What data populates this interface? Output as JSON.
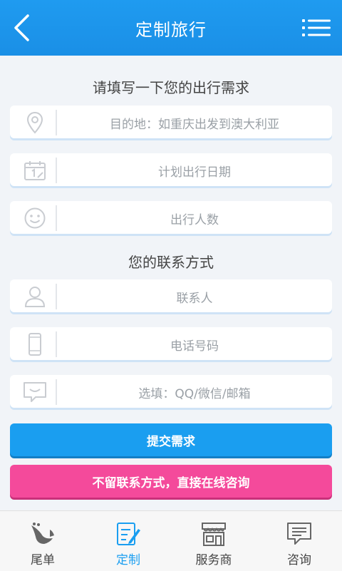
{
  "header": {
    "title": "定制旅行",
    "back_icon": "back-chevron-icon",
    "menu_icon": "list-menu-icon"
  },
  "needs": {
    "title": "请填写一下您的出行需求",
    "fields": [
      {
        "icon": "location-pin-icon",
        "placeholder": "目的地：如重庆出发到澳大利亚"
      },
      {
        "icon": "calendar-icon",
        "placeholder": "计划出行日期"
      },
      {
        "icon": "smiley-icon",
        "placeholder": "出行人数"
      }
    ]
  },
  "contact": {
    "title": "您的联系方式",
    "fields": [
      {
        "icon": "person-icon",
        "placeholder": "联系人"
      },
      {
        "icon": "phone-icon",
        "placeholder": "电话号码"
      },
      {
        "icon": "chat-icon",
        "placeholder": "选填：QQ/微信/邮箱"
      }
    ]
  },
  "buttons": {
    "submit": "提交需求",
    "online_consult": "不留联系方式，直接在线咨询"
  },
  "tabbar": {
    "active_color": "#1a9ef0",
    "items": [
      {
        "label": "尾单",
        "icon": "bird-icon"
      },
      {
        "label": "定制",
        "icon": "edit-document-icon",
        "active": true
      },
      {
        "label": "服务商",
        "icon": "storefront-icon"
      },
      {
        "label": "咨询",
        "icon": "message-icon"
      }
    ]
  }
}
